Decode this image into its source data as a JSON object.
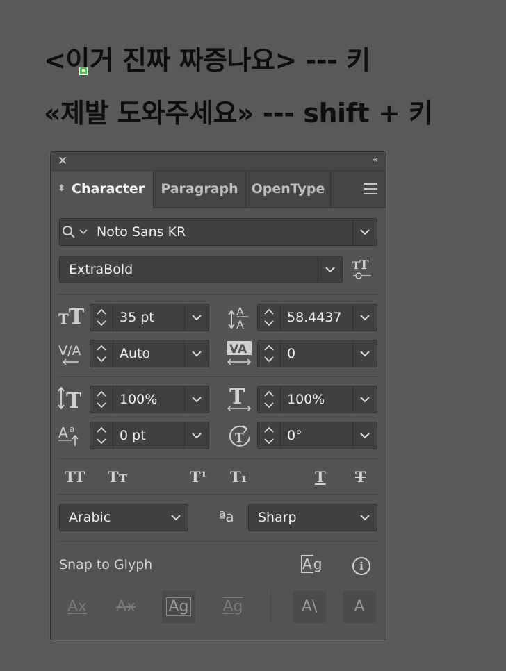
{
  "canvas": {
    "line1": "<이거 진짜 짜증나요> --- 키",
    "line2": "«제발 도와주세요» --- shift + 키"
  },
  "panel": {
    "close_icon": "close-icon",
    "collapse_icon": "«",
    "tabs": [
      {
        "label": "Character",
        "active": true
      },
      {
        "label": "Paragraph",
        "active": false
      },
      {
        "label": "OpenType",
        "active": false
      }
    ],
    "font_family": "Noto Sans KR",
    "font_style": "ExtraBold",
    "font_size": "35 pt",
    "leading": "58.4437",
    "kerning": "Auto",
    "tracking": "0",
    "vertical_scale": "100%",
    "horizontal_scale": "100%",
    "baseline_shift": "0 pt",
    "rotation": "0°",
    "language": "Arabic",
    "antialias": "Sharp",
    "aa_icon": "ªa",
    "snap_label": "Snap to Glyph",
    "format_buttons": [
      "TT",
      "Tт",
      "T¹",
      "T₁",
      "T",
      "T"
    ],
    "snap_buttons": [
      "Ax",
      "Ax",
      "Ag",
      "Ag",
      "A\\",
      "A"
    ]
  },
  "colors": {
    "background": "#595959",
    "panel": "#535353",
    "field": "#404040",
    "handle": "#48c83a"
  }
}
